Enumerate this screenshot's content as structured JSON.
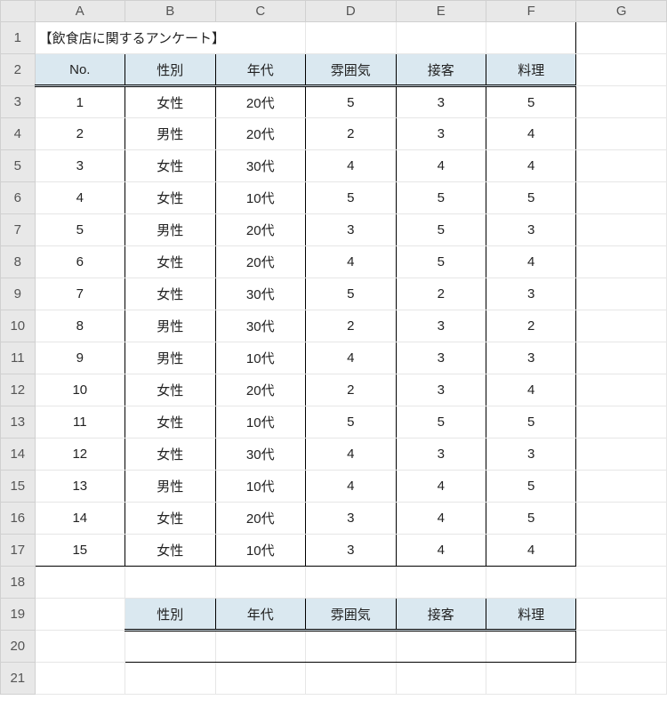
{
  "colLetters": [
    "A",
    "B",
    "C",
    "D",
    "E",
    "F",
    "G"
  ],
  "rowNumbers": [
    "1",
    "2",
    "3",
    "4",
    "5",
    "6",
    "7",
    "8",
    "9",
    "10",
    "11",
    "12",
    "13",
    "14",
    "15",
    "16",
    "17",
    "18",
    "19",
    "20",
    "21"
  ],
  "title": "【飲食店に関するアンケート】",
  "headers": {
    "no": "No.",
    "sex": "性別",
    "age": "年代",
    "atmos": "雰囲気",
    "service": "接客",
    "food": "料理"
  },
  "rows": [
    {
      "no": "1",
      "sex": "女性",
      "age": "20代",
      "atmos": "5",
      "service": "3",
      "food": "5"
    },
    {
      "no": "2",
      "sex": "男性",
      "age": "20代",
      "atmos": "2",
      "service": "3",
      "food": "4"
    },
    {
      "no": "3",
      "sex": "女性",
      "age": "30代",
      "atmos": "4",
      "service": "4",
      "food": "4"
    },
    {
      "no": "4",
      "sex": "女性",
      "age": "10代",
      "atmos": "5",
      "service": "5",
      "food": "5"
    },
    {
      "no": "5",
      "sex": "男性",
      "age": "20代",
      "atmos": "3",
      "service": "5",
      "food": "3"
    },
    {
      "no": "6",
      "sex": "女性",
      "age": "20代",
      "atmos": "4",
      "service": "5",
      "food": "4"
    },
    {
      "no": "7",
      "sex": "女性",
      "age": "30代",
      "atmos": "5",
      "service": "2",
      "food": "3"
    },
    {
      "no": "8",
      "sex": "男性",
      "age": "30代",
      "atmos": "2",
      "service": "3",
      "food": "2"
    },
    {
      "no": "9",
      "sex": "男性",
      "age": "10代",
      "atmos": "4",
      "service": "3",
      "food": "3"
    },
    {
      "no": "10",
      "sex": "女性",
      "age": "20代",
      "atmos": "2",
      "service": "3",
      "food": "4"
    },
    {
      "no": "11",
      "sex": "女性",
      "age": "10代",
      "atmos": "5",
      "service": "5",
      "food": "5"
    },
    {
      "no": "12",
      "sex": "女性",
      "age": "30代",
      "atmos": "4",
      "service": "3",
      "food": "3"
    },
    {
      "no": "13",
      "sex": "男性",
      "age": "10代",
      "atmos": "4",
      "service": "4",
      "food": "5"
    },
    {
      "no": "14",
      "sex": "女性",
      "age": "20代",
      "atmos": "3",
      "service": "4",
      "food": "5"
    },
    {
      "no": "15",
      "sex": "女性",
      "age": "10代",
      "atmos": "3",
      "service": "4",
      "food": "4"
    }
  ],
  "criteriaHeaders": {
    "sex": "性別",
    "age": "年代",
    "atmos": "雰囲気",
    "service": "接客",
    "food": "料理"
  },
  "criteriaValues": {
    "sex": "",
    "age": "",
    "atmos": "",
    "service": "",
    "food": ""
  }
}
